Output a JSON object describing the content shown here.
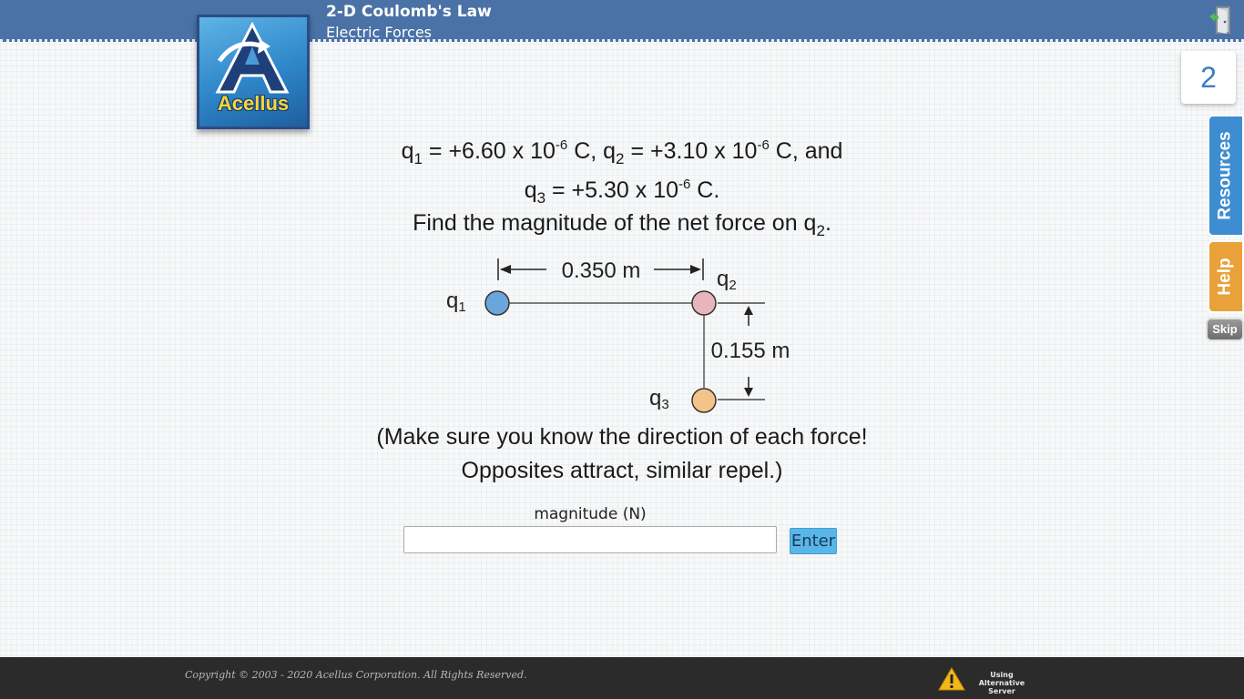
{
  "header": {
    "title": "2-D Coulomb's Law",
    "subtitle": "Electric Forces",
    "exit_icon": "door-exit-icon"
  },
  "logo": {
    "text": "Acellus"
  },
  "question_number": "2",
  "sidebar": {
    "resources_label": "Resources",
    "help_label": "Help",
    "skip_label": "Skip"
  },
  "question": {
    "line1": {
      "q1_sym": "q",
      "q1_sub": "1",
      "q1_val": " = +6.60 x 10",
      "q1_exp": "-6",
      "mid": " C, q",
      "q2_sub": "2",
      "q2_val": " = +3.10 x 10",
      "q2_exp": "-6",
      "end": " C, and"
    },
    "line2": {
      "q3_sym": "q",
      "q3_sub": "3",
      "q3_val": " = +5.30 x 10",
      "q3_exp": "-6",
      "end": " C."
    },
    "line3": {
      "text": "Find the magnitude of the net force on q",
      "sub": "2",
      "end": "."
    }
  },
  "diagram": {
    "q1_label": "q",
    "q1_sub": "1",
    "q2_label": "q",
    "q2_sub": "2",
    "q3_label": "q",
    "q3_sub": "3",
    "horizontal_distance": "0.350 m",
    "vertical_distance": "0.155 m",
    "colors": {
      "q1": "#6aa6dc",
      "q2": "#e8b4bd",
      "q3": "#f3c48a"
    }
  },
  "note": {
    "line1": "(Make sure you know the direction of each force!",
    "line2": "Opposites attract, similar repel.)"
  },
  "answer": {
    "label": "magnitude (N)",
    "value": "",
    "button_label": "Enter"
  },
  "footer": {
    "copyright": "Copyright © 2003 - 2020 Acellus Corporation.  All Rights Reserved.",
    "server_status": "Using Alternative Server",
    "warning_icon": "warning-icon"
  }
}
